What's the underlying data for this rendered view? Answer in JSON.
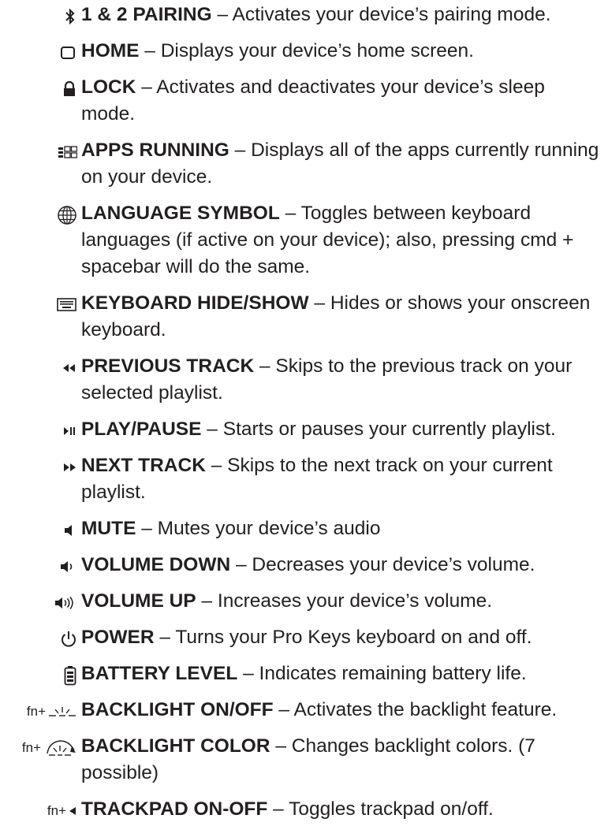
{
  "items": [
    {
      "icon": "bluetooth-icon",
      "title": "1 & 2 PAIRING",
      "text": " – Activates your device’s pairing mode."
    },
    {
      "icon": "home-icon",
      "title": "HOME",
      "text": " – Displays your device’s home screen."
    },
    {
      "icon": "lock-icon",
      "title": "LOCK",
      "text": " – Activates and deactivates your device’s sleep mode."
    },
    {
      "icon": "apps-running-icon",
      "title": "APPS RUNNING",
      "text": " – Displays all of the apps currently running on your device."
    },
    {
      "icon": "globe-icon",
      "title": "LANGUAGE SYMBOL",
      "text": " – Toggles between keyboard languages (if active on your device); also, pressing cmd + spacebar will do the same."
    },
    {
      "icon": "keyboard-icon",
      "title": "KEYBOARD HIDE/SHOW",
      "text": " – Hides or shows your onscreen keyboard."
    },
    {
      "icon": "previous-track-icon",
      "title": "PREVIOUS TRACK",
      "text": " – Skips to the previous track on your selected playlist."
    },
    {
      "icon": "play-pause-icon",
      "title": "PLAY/PAUSE",
      "text": " – Starts or pauses your currently playlist."
    },
    {
      "icon": "next-track-icon",
      "title": "NEXT TRACK",
      "text": " – Skips to the next track on your current playlist."
    },
    {
      "icon": "mute-icon",
      "title": "MUTE",
      "text": " – Mutes your device’s audio"
    },
    {
      "icon": "volume-down-icon",
      "title": "VOLUME DOWN",
      "text": " – Decreases your device’s volume."
    },
    {
      "icon": "volume-up-icon",
      "title": "VOLUME UP",
      "text": " – Increases your device’s volume."
    },
    {
      "icon": "power-icon",
      "title": "POWER",
      "text": " – Turns your Pro Keys keyboard on and off."
    },
    {
      "icon": "battery-icon",
      "title": "BATTERY LEVEL",
      "text": " – Indicates remaining battery life."
    },
    {
      "icon": "backlight-icon",
      "prefix": "fn+",
      "title": "BACKLIGHT ON/OFF",
      "text": " – Activates the backlight feature."
    },
    {
      "icon": "backlight-color-icon",
      "prefix": "fn+",
      "title": "BACKLIGHT COLOR",
      "text": " – Changes backlight colors. (7 possible)"
    },
    {
      "icon": "trackpad-icon",
      "prefix": "fn+",
      "title": "TRACKPAD ON-OFF",
      "text": " – Toggles trackpad on/off."
    }
  ]
}
